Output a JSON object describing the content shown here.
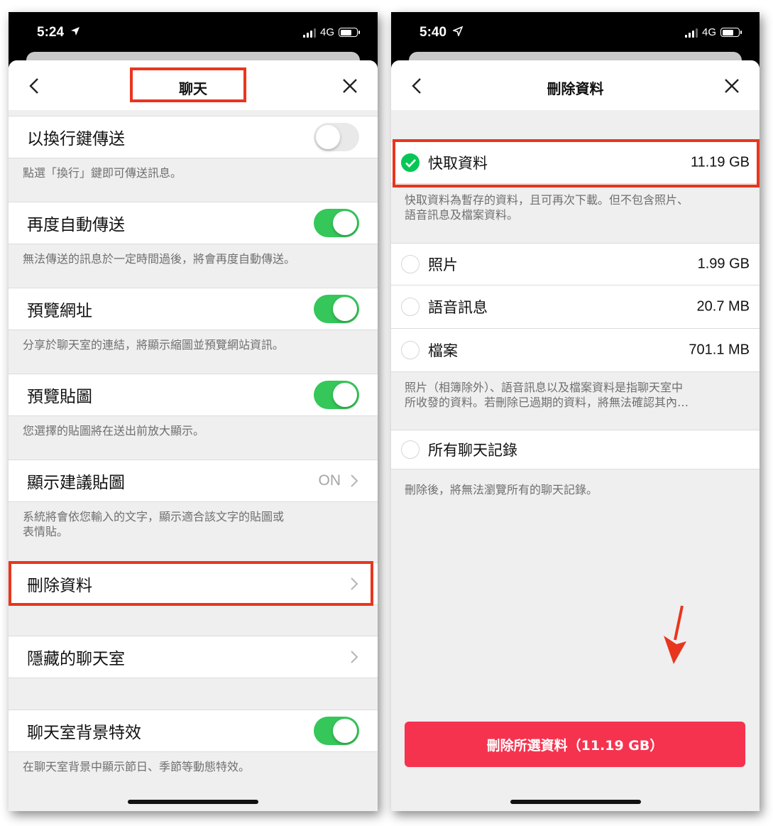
{
  "colors": {
    "accent_red": "#e8361e",
    "toggle_green": "#35c759",
    "check_green": "#06c755",
    "delete_button": "#f5334f"
  },
  "left": {
    "status": {
      "time": "5:24",
      "network": "4G",
      "location_icon": "location-arrow-icon"
    },
    "nav": {
      "title": "聊天",
      "back_icon": "chevron-left-icon",
      "close_icon": "close-icon"
    },
    "settings": [
      {
        "label": "以換行鍵傳送",
        "toggle": false,
        "desc": "點選「換行」鍵即可傳送訊息。"
      },
      {
        "label": "再度自動傳送",
        "toggle": true,
        "desc": "無法傳送的訊息於一定時間過後，將會再度自動傳送。"
      },
      {
        "label": "預覽網址",
        "toggle": true,
        "desc": "分享於聊天室的連結，將顯示縮圖並預覽網站資訊。"
      },
      {
        "label": "預覽貼圖",
        "toggle": true,
        "desc": "您選擇的貼圖將在送出前放大顯示。"
      },
      {
        "label": "顯示建議貼圖",
        "value": "ON",
        "desc_line1": "系統將會依您輸入的文字，顯示適合該文字的貼圖或",
        "desc_line2": "表情貼。"
      },
      {
        "label": "刪除資料"
      },
      {
        "label": "隱藏的聊天室"
      },
      {
        "label": "聊天室背景特效",
        "toggle": true,
        "desc": "在聊天室背景中顯示節日、季節等動態特效。"
      }
    ]
  },
  "right": {
    "status": {
      "time": "5:40",
      "network": "4G",
      "location_icon": "location-arrow-outline-icon"
    },
    "nav": {
      "title": "刪除資料",
      "back_icon": "chevron-left-icon",
      "close_icon": "close-icon"
    },
    "cache": {
      "label": "快取資料",
      "size": "11.19 GB",
      "checked": true
    },
    "cache_desc": {
      "line1": "快取資料為暫存的資料，且可再次下載。但不包含照片、",
      "line2": "語音訊息及檔案資料。"
    },
    "options": [
      {
        "label": "照片",
        "size": "1.99 GB",
        "checked": false
      },
      {
        "label": "語音訊息",
        "size": "20.7 MB",
        "checked": false
      },
      {
        "label": "檔案",
        "size": "701.1 MB",
        "checked": false
      }
    ],
    "options_desc": {
      "line1": "照片（相簿除外）、語音訊息以及檔案資料是指聊天室中",
      "line2": "所收發的資料。若刪除已過期的資料，將無法確認其內…"
    },
    "history": {
      "label": "所有聊天記錄",
      "checked": false
    },
    "history_desc": "刪除後，將無法瀏覽所有的聊天記錄。",
    "delete_button": "刪除所選資料（11.19 GB）"
  }
}
